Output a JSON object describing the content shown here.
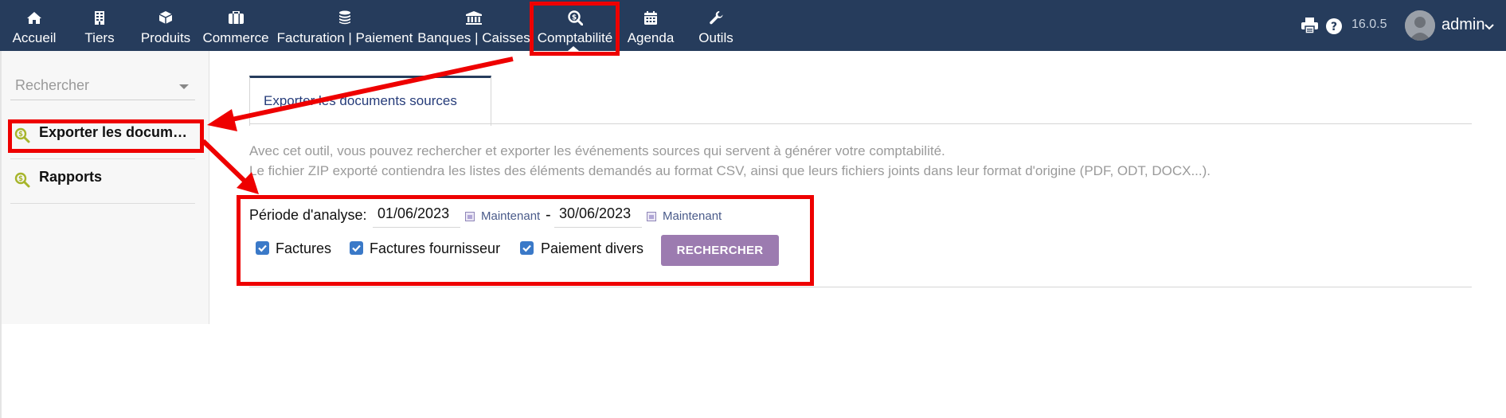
{
  "topnav": {
    "items": [
      {
        "label": "Accueil",
        "icon": "home-icon"
      },
      {
        "label": "Tiers",
        "icon": "building-icon"
      },
      {
        "label": "Produits",
        "icon": "cube-icon"
      },
      {
        "label": "Commerce",
        "icon": "briefcase-icon"
      },
      {
        "label": "Facturation | Paiement",
        "icon": "coins-icon"
      },
      {
        "label": "Banques | Caisses",
        "icon": "bank-icon"
      },
      {
        "label": "Comptabilité",
        "icon": "search-dollar-icon",
        "active": true
      },
      {
        "label": "Agenda",
        "icon": "calendar-icon"
      },
      {
        "label": "Outils",
        "icon": "wrench-icon"
      }
    ],
    "version": "16.0.5",
    "user": "admin"
  },
  "sidebar": {
    "search_placeholder": "Rechercher",
    "items": [
      {
        "label": "Exporter les documents sources",
        "icon": "search-dollar-icon"
      },
      {
        "label": "Rapports",
        "icon": "search-dollar-icon"
      }
    ]
  },
  "main": {
    "tab_label": "Exporter les documents sources",
    "description_line1": "Avec cet outil, vous pouvez rechercher et exporter les événements sources qui servent à générer votre comptabilité.",
    "description_line2": "Le fichier ZIP exporté contiendra les listes des éléments demandés au format CSV, ainsi que leurs fichiers joints dans leur format d'origine (PDF, ODT, DOCX...).",
    "period_label": "Période d'analyse:",
    "date_start": "01/06/2023",
    "date_end": "30/06/2023",
    "now_label": "Maintenant",
    "separator": "-",
    "checkboxes": [
      {
        "label": "Factures",
        "checked": true
      },
      {
        "label": "Factures fournisseur",
        "checked": true
      },
      {
        "label": "Paiement divers",
        "checked": true
      }
    ],
    "search_button": "RECHERCHER"
  },
  "colors": {
    "topbar": "#263c5c",
    "button": "#9c7bb0",
    "checkbox": "#3a79c8",
    "annotation": "#ee0000",
    "menu_icon": "#a7b52c"
  }
}
